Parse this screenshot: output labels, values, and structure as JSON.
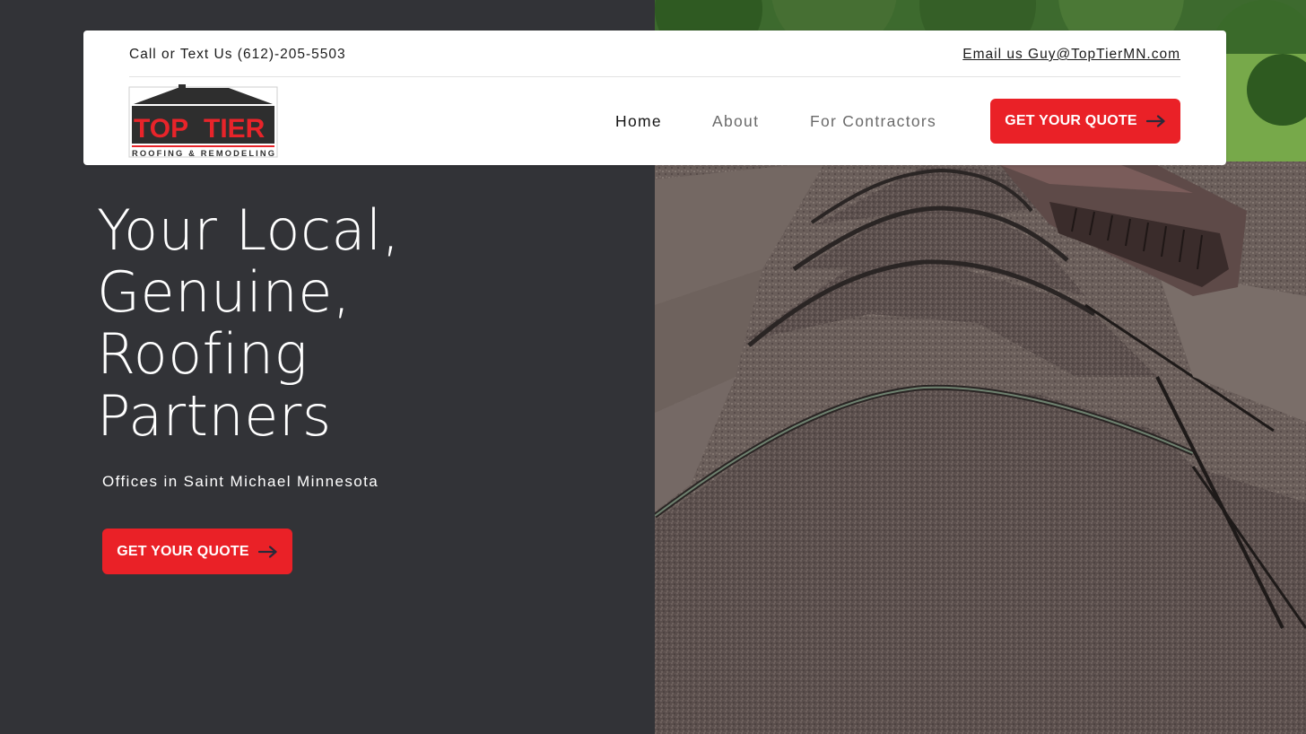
{
  "topbar": {
    "phone_text": "Call or Text Us (612)-205-5503",
    "email_text": "Email us Guy@TopTierMN.com"
  },
  "logo": {
    "line1_a": "TOP",
    "line1_b": "TIER",
    "line2": "ROOFING & REMODELING"
  },
  "nav": {
    "items": [
      {
        "label": "Home",
        "active": true
      },
      {
        "label": "About",
        "active": false
      },
      {
        "label": "For Contractors",
        "active": false
      }
    ],
    "cta_label": "GET YOUR QUOTE"
  },
  "hero": {
    "title_lines": [
      "Your Local,",
      "Genuine,",
      "Roofing",
      "Partners"
    ],
    "subtitle": "Offices in Saint Michael Minnesota",
    "cta_label": "GET YOUR QUOTE"
  },
  "icons": {
    "arrow": "arrow-right-icon"
  },
  "colors": {
    "accent": "#ea2127",
    "dark_bg": "#323337",
    "header_bg": "#ffffff",
    "arrow_color": "#2a2a3a"
  }
}
